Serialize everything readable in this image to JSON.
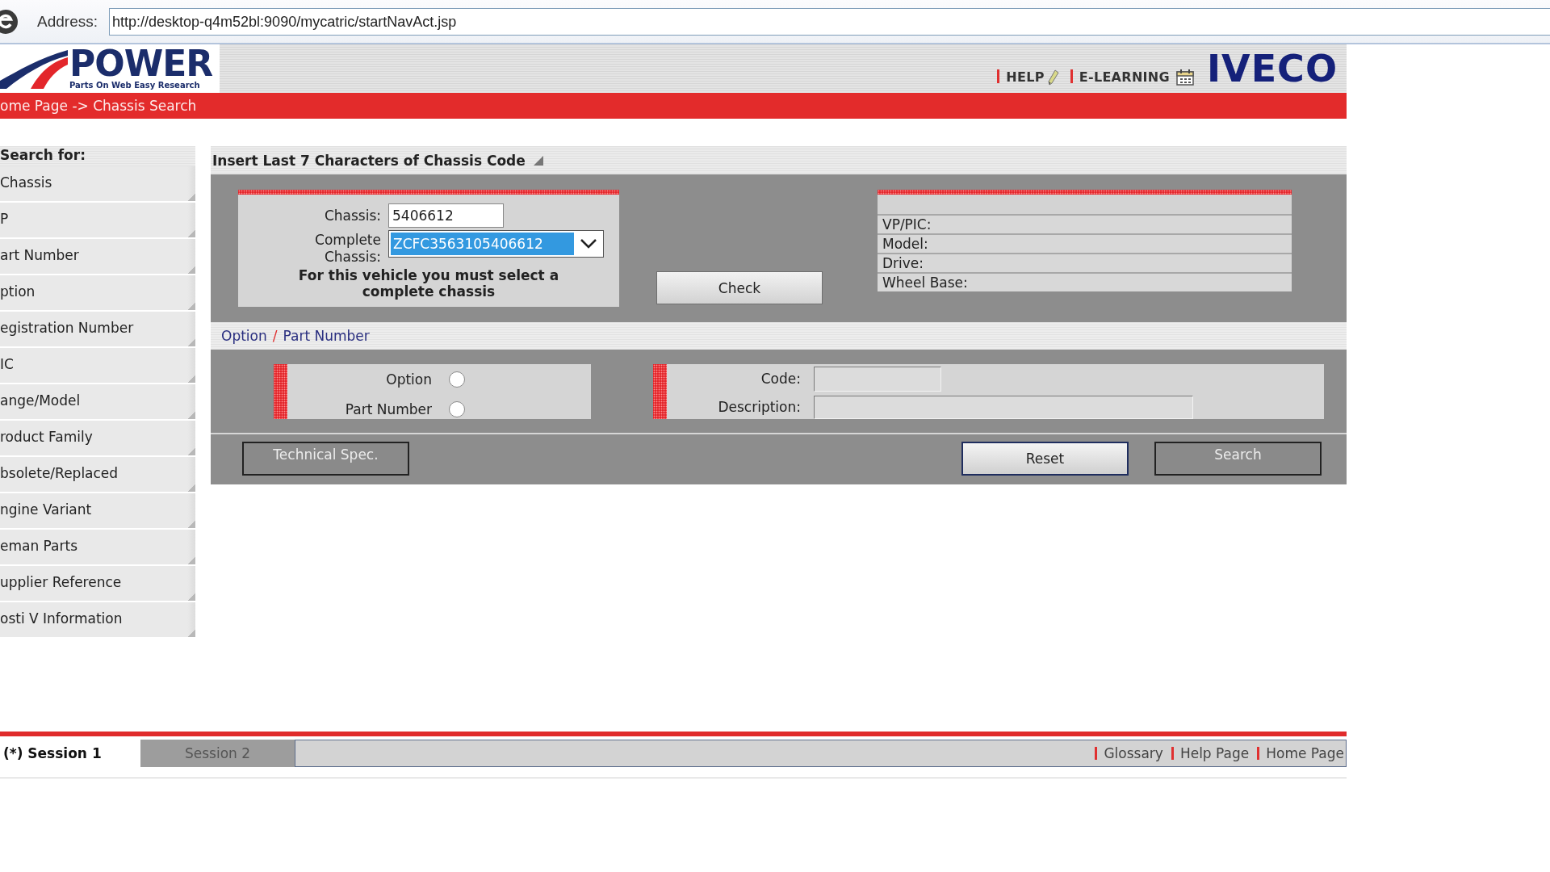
{
  "browser": {
    "address_label": "Address:",
    "url": "http://desktop-q4m52bl:9090/mycatric/startNavAct.jsp"
  },
  "header": {
    "logo_title": "POWER",
    "logo_tagline": "Parts On Web Easy Research",
    "links": [
      {
        "label": "HELP",
        "kind": "help"
      },
      {
        "label": "E-LEARNING",
        "kind": "learning"
      }
    ],
    "brand": "IVECO"
  },
  "breadcrumb": "ome Page -> Chassis Search",
  "sidebar": {
    "title": "Search for:",
    "items": [
      "Chassis",
      "P",
      "art Number",
      "ption",
      "egistration Number",
      "IC",
      "ange/Model",
      "roduct Family",
      "bsolete/Replaced",
      "ngine Variant",
      "eman Parts",
      "upplier Reference",
      "osti V Information"
    ]
  },
  "chassis_panel": {
    "title": "Insert Last 7 Characters of Chassis Code",
    "chassis_label": "Chassis:",
    "chassis_value": "5406612",
    "complete_label": "Complete Chassis:",
    "complete_value": "ZCFC3563105406612",
    "note": "For this vehicle you must select a complete chassis",
    "check_button": "Check",
    "vehicle_info": [
      "VP/PIC:",
      "Model:",
      "Drive:",
      "Wheel Base:"
    ]
  },
  "option_panel": {
    "heading": [
      "Option",
      "Part Number"
    ],
    "heading_separator": "/",
    "radios": [
      {
        "label": "Option",
        "selected": false
      },
      {
        "label": "Part Number",
        "selected": false
      }
    ],
    "fields": [
      {
        "label": "Code:",
        "kind": "short"
      },
      {
        "label": "Description:",
        "kind": "long"
      }
    ],
    "buttons": [
      {
        "label": "Technical Spec.",
        "disabled": true
      },
      {
        "label": "Reset",
        "disabled": false
      },
      {
        "label": "Search",
        "disabled": true
      }
    ]
  },
  "session_bar": {
    "tabs": [
      {
        "label": "(*) Session 1",
        "selected": true
      },
      {
        "label": "Session 2",
        "selected": false
      }
    ],
    "links": [
      "Glossary",
      "Help Page",
      "Home Page"
    ]
  }
}
